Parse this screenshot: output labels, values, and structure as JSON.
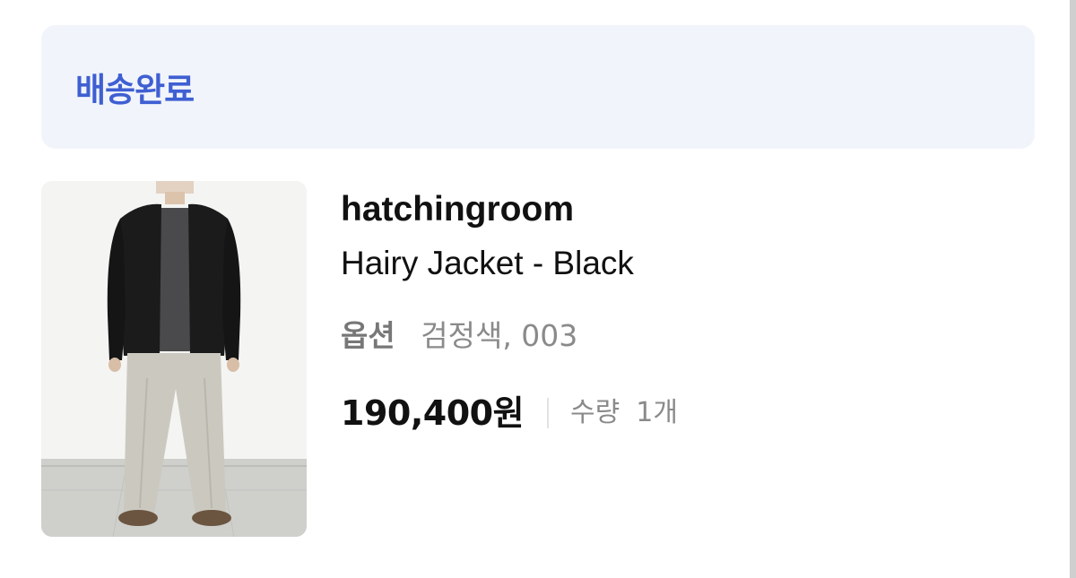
{
  "order": {
    "status_label": "배송완료",
    "status_color": "#3f5fd2"
  },
  "product": {
    "image_description_icon": "product-photo",
    "brand": "hatchingroom",
    "name": "Hairy Jacket - Black",
    "option_label": "옵션",
    "option_value": "검정색, 003",
    "price": "190,400원",
    "quantity_label": "수량",
    "quantity_value": "1개"
  }
}
